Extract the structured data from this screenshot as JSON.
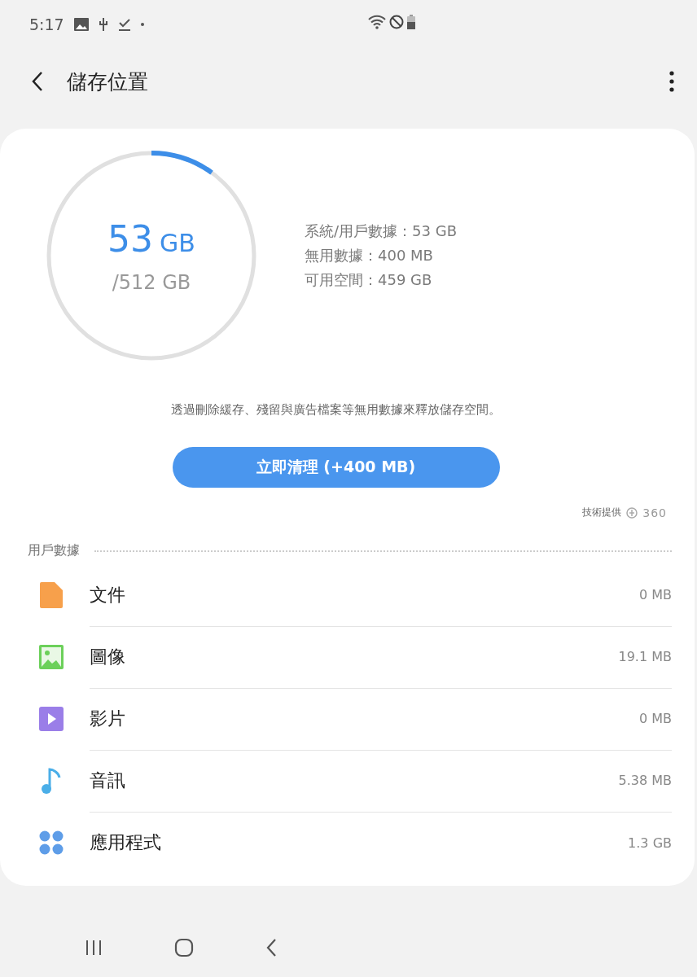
{
  "status_bar": {
    "time": "5:17"
  },
  "header": {
    "title": "儲存位置"
  },
  "usage": {
    "used": "53",
    "used_unit": "GB",
    "total": "/512 GB",
    "details": [
      "系統/用戶數據：53 GB",
      "無用數據：400 MB",
      "可用空間：459 GB"
    ]
  },
  "description": "透過刪除緩存、殘留與廣告檔案等無用數據來釋放儲存空間。",
  "clean_button": "立即清理 (+400 MB)",
  "credit": {
    "label": "技術提供",
    "brand": "360"
  },
  "section": {
    "title": "用戶數據",
    "items": [
      {
        "kind": "document",
        "color": "#f7a04b",
        "label": "文件",
        "size": "0 MB"
      },
      {
        "kind": "image",
        "color": "#6cd05a",
        "label": "圖像",
        "size": "19.1 MB"
      },
      {
        "kind": "video",
        "color": "#9a7ee8",
        "label": "影片",
        "size": "0 MB"
      },
      {
        "kind": "audio",
        "color": "#4aaee8",
        "label": "音訊",
        "size": "5.38 MB"
      },
      {
        "kind": "apps",
        "color": "#5e9de8",
        "label": "應用程式",
        "size": "1.3 GB"
      }
    ]
  }
}
